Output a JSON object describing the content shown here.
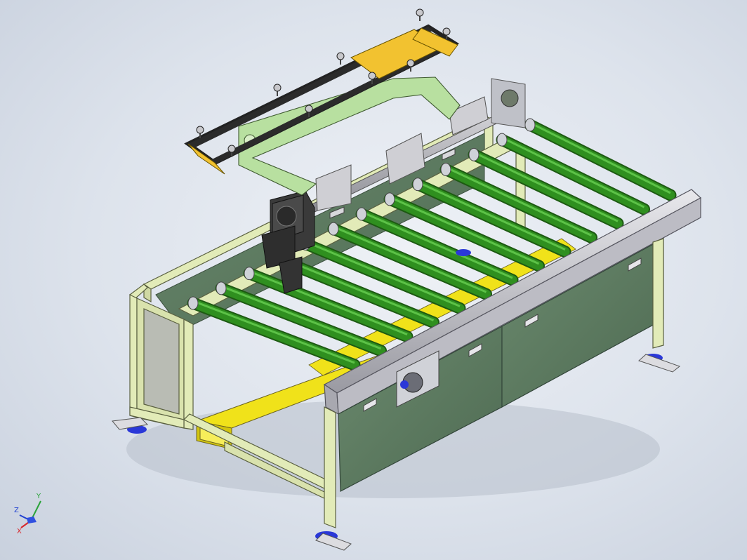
{
  "viewport": {
    "background_top": "#eef1f6",
    "background_bottom": "#c9d1de"
  },
  "triad": {
    "x_label": "X",
    "y_label": "Y",
    "z_label": "Z",
    "x_color": "#d8262b",
    "y_color": "#2aa33a",
    "z_color": "#2040d0"
  },
  "colors": {
    "frame": "#e2ebb8",
    "frame_edge": "#5a6040",
    "panel": "#5f7d63",
    "panel_dark": "#4b6650",
    "roller": "#2f8f1f",
    "roller_light": "#4fb63a",
    "yellow": "#f0e21a",
    "rail": "#c8c8cc",
    "gripper_frame": "#2b2b2b",
    "gripper_plate": "#f2c230",
    "arm": "#b8e0a0",
    "motor": "#3a3a3a",
    "foot": "#2a38d8"
  },
  "model": {
    "roller_count": 13
  }
}
